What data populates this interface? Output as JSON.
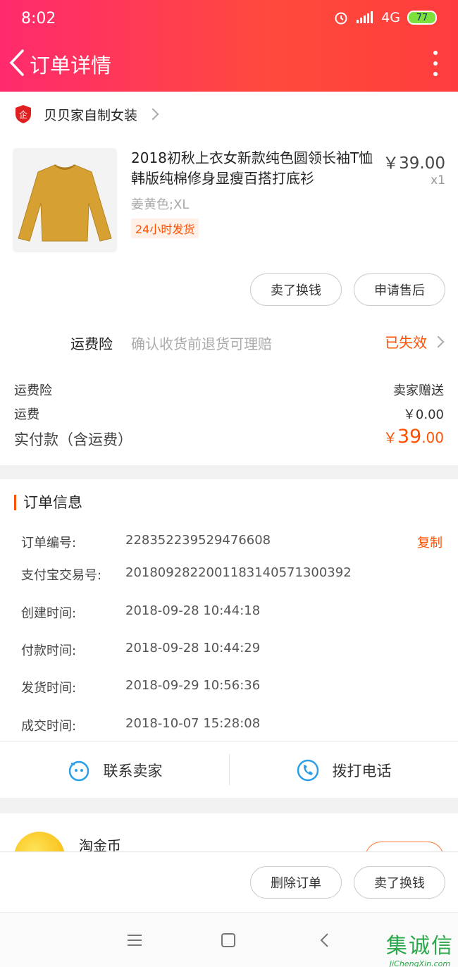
{
  "status_bar": {
    "time": "8:02",
    "network": "4G",
    "battery": "77"
  },
  "nav": {
    "title": "订单详情"
  },
  "shop": {
    "name": "贝贝家自制女装",
    "badge": "企"
  },
  "product": {
    "title": "2018初秋上衣女新款纯色圆领长袖T恤韩版纯棉修身显瘦百搭打底衫",
    "price": "￥39.00",
    "qty": "x1",
    "sku": "姜黄色;XL",
    "tag": "24小时发货"
  },
  "item_actions": {
    "resell": "卖了换钱",
    "after_sale": "申请售后"
  },
  "insurance": {
    "label": "运费险",
    "desc": "确认收货前退货可理赔",
    "status": "已失效"
  },
  "fees": {
    "insurance_label": "运费险",
    "insurance_value": "卖家赠送",
    "shipping_label": "运费",
    "shipping_value": "￥0.00",
    "total_label": "实付款（含运费）",
    "total_symbol": "￥",
    "total_int": "39",
    "total_dec": ".00"
  },
  "order_info": {
    "title": "订单信息",
    "copy_label": "复制",
    "rows": [
      {
        "key": "订单编号:",
        "value": "228352239529476608"
      },
      {
        "key": "支付宝交易号:",
        "value": "2018092822001183140571300392"
      },
      {
        "key": "创建时间:",
        "value": "2018-09-28 10:44:18"
      },
      {
        "key": "付款时间:",
        "value": "2018-09-28 10:44:29"
      },
      {
        "key": "发货时间:",
        "value": "2018-09-29 10:56:36"
      },
      {
        "key": "成交时间:",
        "value": "2018-10-07 15:28:08"
      }
    ]
  },
  "contact": {
    "seller": "联系卖家",
    "phone": "拨打电话"
  },
  "coin": {
    "label": "淘金币"
  },
  "bottom_actions": {
    "delete": "删除订单",
    "resell": "卖了换钱"
  },
  "watermark": {
    "main": "集诚信",
    "sub": "JiChengXin.com"
  },
  "colors": {
    "accent": "#ff5000",
    "header_start": "#ff2a6d",
    "header_end": "#ff3d3d"
  }
}
